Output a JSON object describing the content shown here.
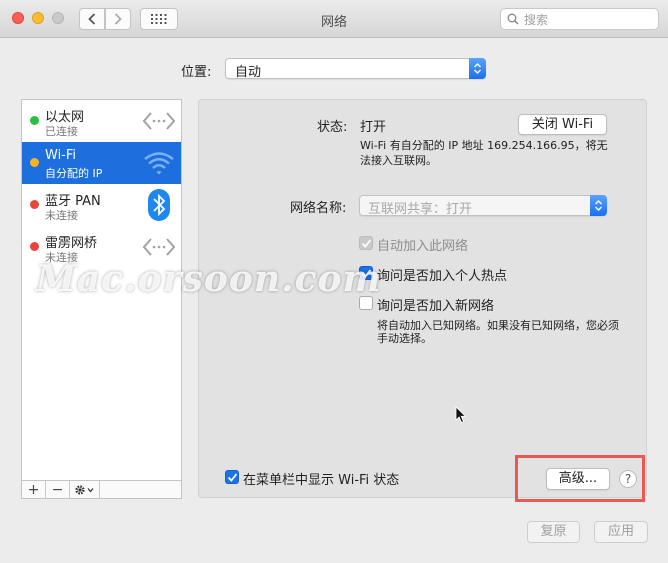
{
  "window": {
    "title": "网络",
    "search_placeholder": "搜索"
  },
  "location": {
    "label": "位置:",
    "value": "自动"
  },
  "services": [
    {
      "name": "以太网",
      "status": "已连接",
      "dot_color": "#2bbf41",
      "icon": "ethernet-arrows-icon"
    },
    {
      "name": "Wi-Fi",
      "status": "自分配的 IP",
      "dot_color": "#f5b623",
      "icon": "wifi-icon",
      "selected": true
    },
    {
      "name": "蓝牙 PAN",
      "status": "未连接",
      "dot_color": "#e8443c",
      "icon": "bluetooth-icon"
    },
    {
      "name": "雷雳网桥",
      "status": "未连接",
      "dot_color": "#e8443c",
      "icon": "ethernet-arrows-icon"
    }
  ],
  "sidebar_toolbar": {
    "add": "+",
    "remove": "−"
  },
  "wifi": {
    "status_label": "状态:",
    "status_value": "打开",
    "toggle_button": "关闭 Wi-Fi",
    "description_line1": "Wi-Fi 有自分配的 IP 地址 169.254.166.95，将无",
    "description_line2": "法接入互联网。",
    "network_name_label": "网络名称:",
    "network_name_value": "互联网共享：打开",
    "auto_join_label": "自动加入此网络",
    "ask_hotspot_label": "询问是否加入个人热点",
    "ask_new_label": "询问是否加入新网络",
    "ask_new_desc_line1": "将自动加入已知网络。如果没有已知网络，您必须",
    "ask_new_desc_line2": "手动选择。",
    "show_menubar_label": "在菜单栏中显示 Wi-Fi 状态",
    "advanced_button": "高级...",
    "help_button": "?"
  },
  "watermark": "Mac.orsoon.com",
  "footer": {
    "revert_button": "复原",
    "apply_button": "应用"
  },
  "colors": {
    "selection": "#1c6fdc",
    "checkbox_on": "#1a74e8",
    "highlight_box": "#e55a52"
  }
}
